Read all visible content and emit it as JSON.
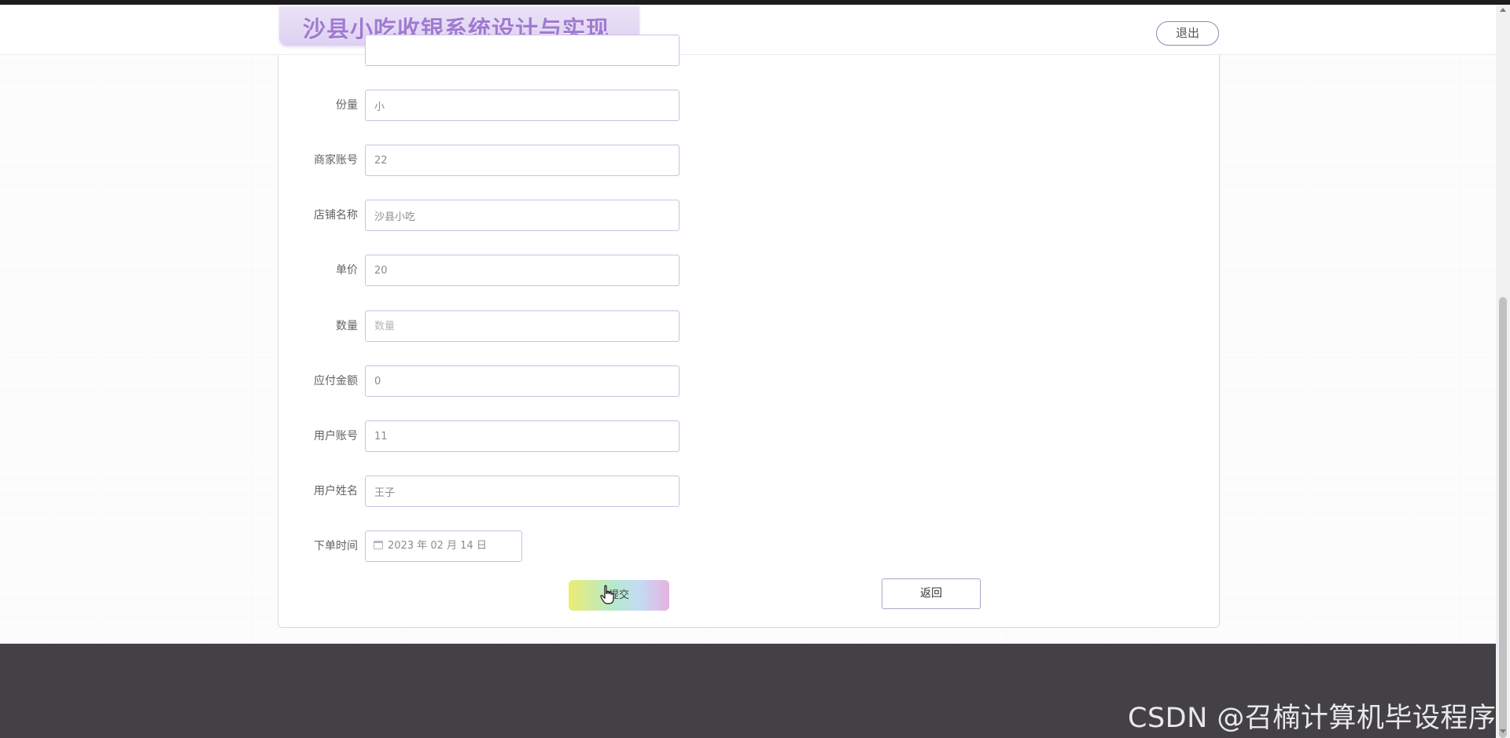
{
  "header": {
    "title": "沙县小吃收银系统设计与实现",
    "logout_label": "退出"
  },
  "form": {
    "partial_field": {
      "label": "",
      "value": ""
    },
    "fields": [
      {
        "name": "portion",
        "label": "份量",
        "value": "小",
        "placeholder": "份量"
      },
      {
        "name": "merchant-account",
        "label": "商家账号",
        "value": "22",
        "placeholder": "商家账号"
      },
      {
        "name": "shop-name",
        "label": "店铺名称",
        "value": "沙县小吃",
        "placeholder": "店铺名称"
      },
      {
        "name": "unit-price",
        "label": "单价",
        "value": "20",
        "placeholder": "单价"
      },
      {
        "name": "quantity",
        "label": "数量",
        "value": "",
        "placeholder": "数量"
      },
      {
        "name": "amount-due",
        "label": "应付金额",
        "value": "0",
        "placeholder": "应付金额"
      },
      {
        "name": "user-account",
        "label": "用户账号",
        "value": "11",
        "placeholder": "用户账号"
      },
      {
        "name": "user-name",
        "label": "用户姓名",
        "value": "王子",
        "placeholder": "用户姓名"
      }
    ],
    "order_time": {
      "label": "下单时间",
      "value": "2023 年 02 月 14 日"
    },
    "submit_label": "提交",
    "back_label": "返回"
  },
  "watermark": "CSDN @召楠计算机毕设程序",
  "colors": {
    "title": "#a07ad0",
    "input_border": "#c9c2e3",
    "footer": "#434145"
  },
  "icons": {
    "calendar": "calendar-icon",
    "cursor": "hand-cursor-icon"
  }
}
